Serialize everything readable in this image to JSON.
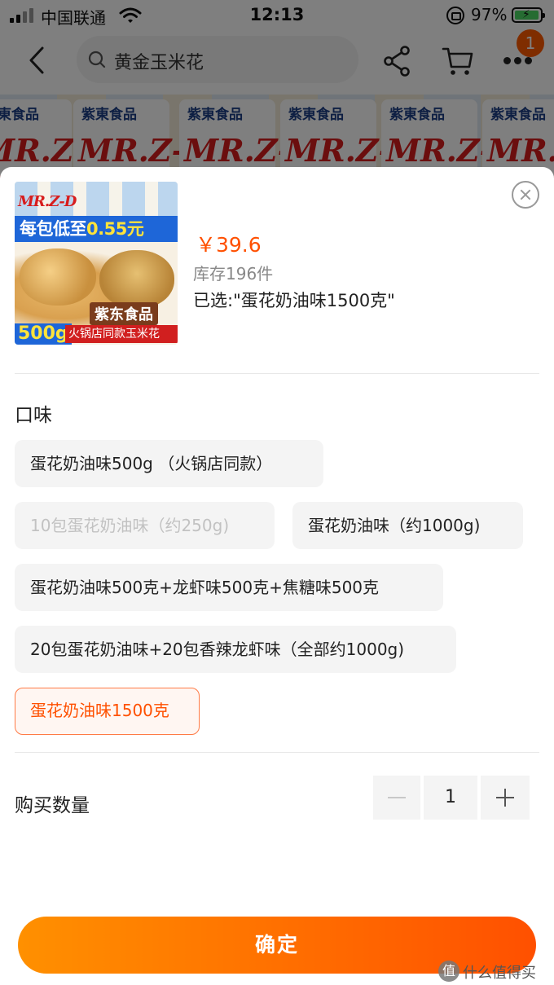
{
  "status_bar": {
    "carrier": "中国联通",
    "time": "12:13",
    "battery_percent": "97%",
    "battery_level": 0.97
  },
  "nav": {
    "back_icon": "chevron-left-icon",
    "search_text": "黄金玉米花",
    "share_icon": "share-icon",
    "cart_icon": "cart-icon",
    "more_icon": "more-icon",
    "badge_count": "1"
  },
  "banner": {
    "bag_brand": "紫東食品",
    "bag_logo": "MR.Z-D"
  },
  "sku_sheet": {
    "thumb": {
      "logo": "MR.Z-D",
      "promo_prefix": "每包低至",
      "promo_price": "0.55元",
      "brand": "紫东食品",
      "weight": "500g",
      "subtitle": "火锅店同款玉米花"
    },
    "price": "￥39.6",
    "stock": "库存196件",
    "selected": "已选:\"蛋花奶油味1500克\"",
    "close_icon": "close-icon",
    "section_title": "口味",
    "options": [
      {
        "label": "蛋花奶油味500g （火锅店同款）",
        "state": "normal"
      },
      {
        "label": "10包蛋花奶油味（约250g)",
        "state": "disabled"
      },
      {
        "label": "蛋花奶油味（约1000g)",
        "state": "normal"
      },
      {
        "label": "蛋花奶油味500克+龙虾味500克+焦糖味500克",
        "state": "normal"
      },
      {
        "label": "20包蛋花奶油味+20包香辣龙虾味（全部约1000g)",
        "state": "normal"
      },
      {
        "label": "蛋花奶油味1500克",
        "state": "selected"
      }
    ],
    "quantity_label": "购买数量",
    "quantity_value": "1",
    "confirm_label": "确定"
  },
  "colors": {
    "accent": "#ff5000",
    "gradient_start": "#ff9000",
    "gradient_end": "#ff5000"
  },
  "watermark": {
    "logo_char": "值",
    "text": "什么值得买"
  }
}
